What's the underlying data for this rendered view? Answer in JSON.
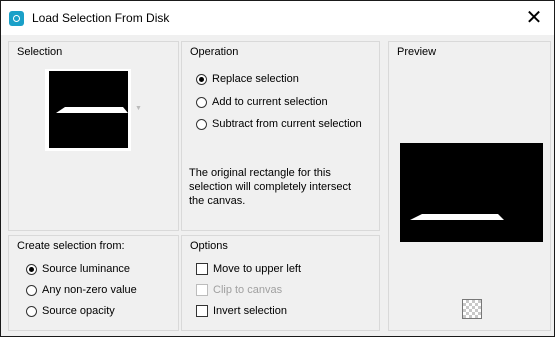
{
  "window": {
    "title": "Load Selection From Disk",
    "close_icon": "✕"
  },
  "selection": {
    "label": "Selection"
  },
  "operation": {
    "label": "Operation",
    "options": [
      "Replace selection",
      "Add to current selection",
      "Subtract from current selection"
    ],
    "selected_index": 0,
    "note": "The original rectangle for this selection will completely intersect the canvas."
  },
  "preview": {
    "label": "Preview"
  },
  "create_from": {
    "label": "Create selection from:",
    "options": [
      "Source luminance",
      "Any non-zero value",
      "Source opacity"
    ],
    "selected_index": 0
  },
  "options_group": {
    "label": "Options",
    "items": [
      {
        "label": "Move to upper left",
        "checked": false,
        "enabled": true
      },
      {
        "label": "Clip to canvas",
        "checked": false,
        "enabled": false
      },
      {
        "label": "Invert selection",
        "checked": false,
        "enabled": true
      }
    ]
  },
  "icons": {
    "app": "selection-app-icon",
    "dropdown": "chevron-down-icon",
    "transparency": "checkerboard-icon"
  }
}
